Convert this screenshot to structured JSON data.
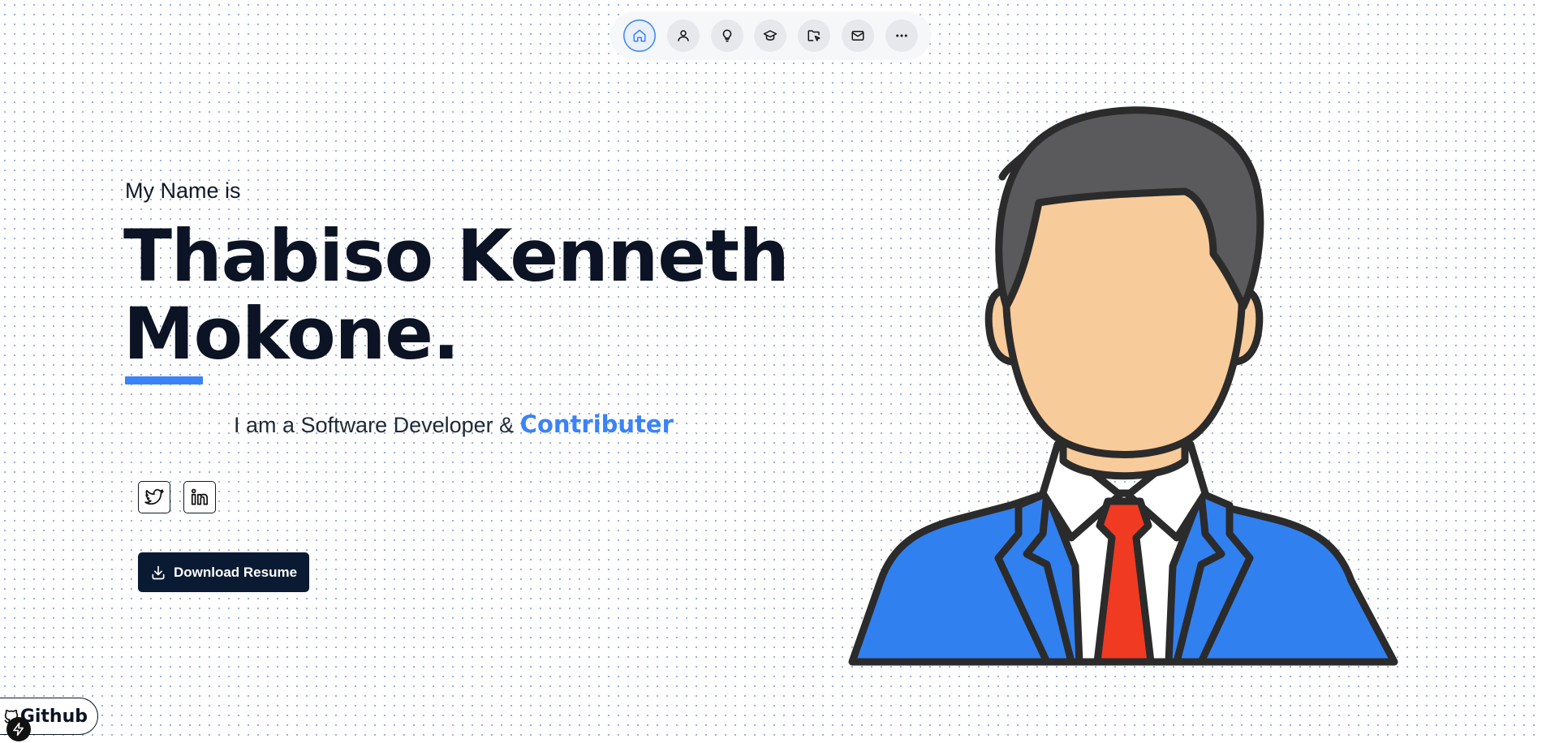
{
  "nav": {
    "items": [
      {
        "icon": "home-icon",
        "active": true
      },
      {
        "icon": "user-icon",
        "active": false
      },
      {
        "icon": "lightbulb-icon",
        "active": false
      },
      {
        "icon": "graduation-cap-icon",
        "active": false
      },
      {
        "icon": "folder-pointer-icon",
        "active": false
      },
      {
        "icon": "mail-icon",
        "active": false
      },
      {
        "icon": "more-icon",
        "active": false
      }
    ]
  },
  "hero": {
    "intro": "My Name is",
    "name_line1": "Thabiso Kenneth",
    "name_line2": "Mokone.",
    "tagline_prefix": "I am a Software Developer & ",
    "tagline_highlight": "Contributer"
  },
  "social": [
    {
      "icon": "twitter-icon"
    },
    {
      "icon": "linkedin-icon"
    }
  ],
  "resume_button": {
    "label": "Download Resume",
    "icon": "download-icon"
  },
  "github_badge": {
    "label": "Github",
    "icon": "github-icon"
  },
  "colors": {
    "accent": "#3b82f6",
    "dark": "#0b1a33",
    "skin": "#f8cb9a",
    "hair": "#5a595b",
    "suit": "#3180f0",
    "tie": "#f03a22"
  }
}
